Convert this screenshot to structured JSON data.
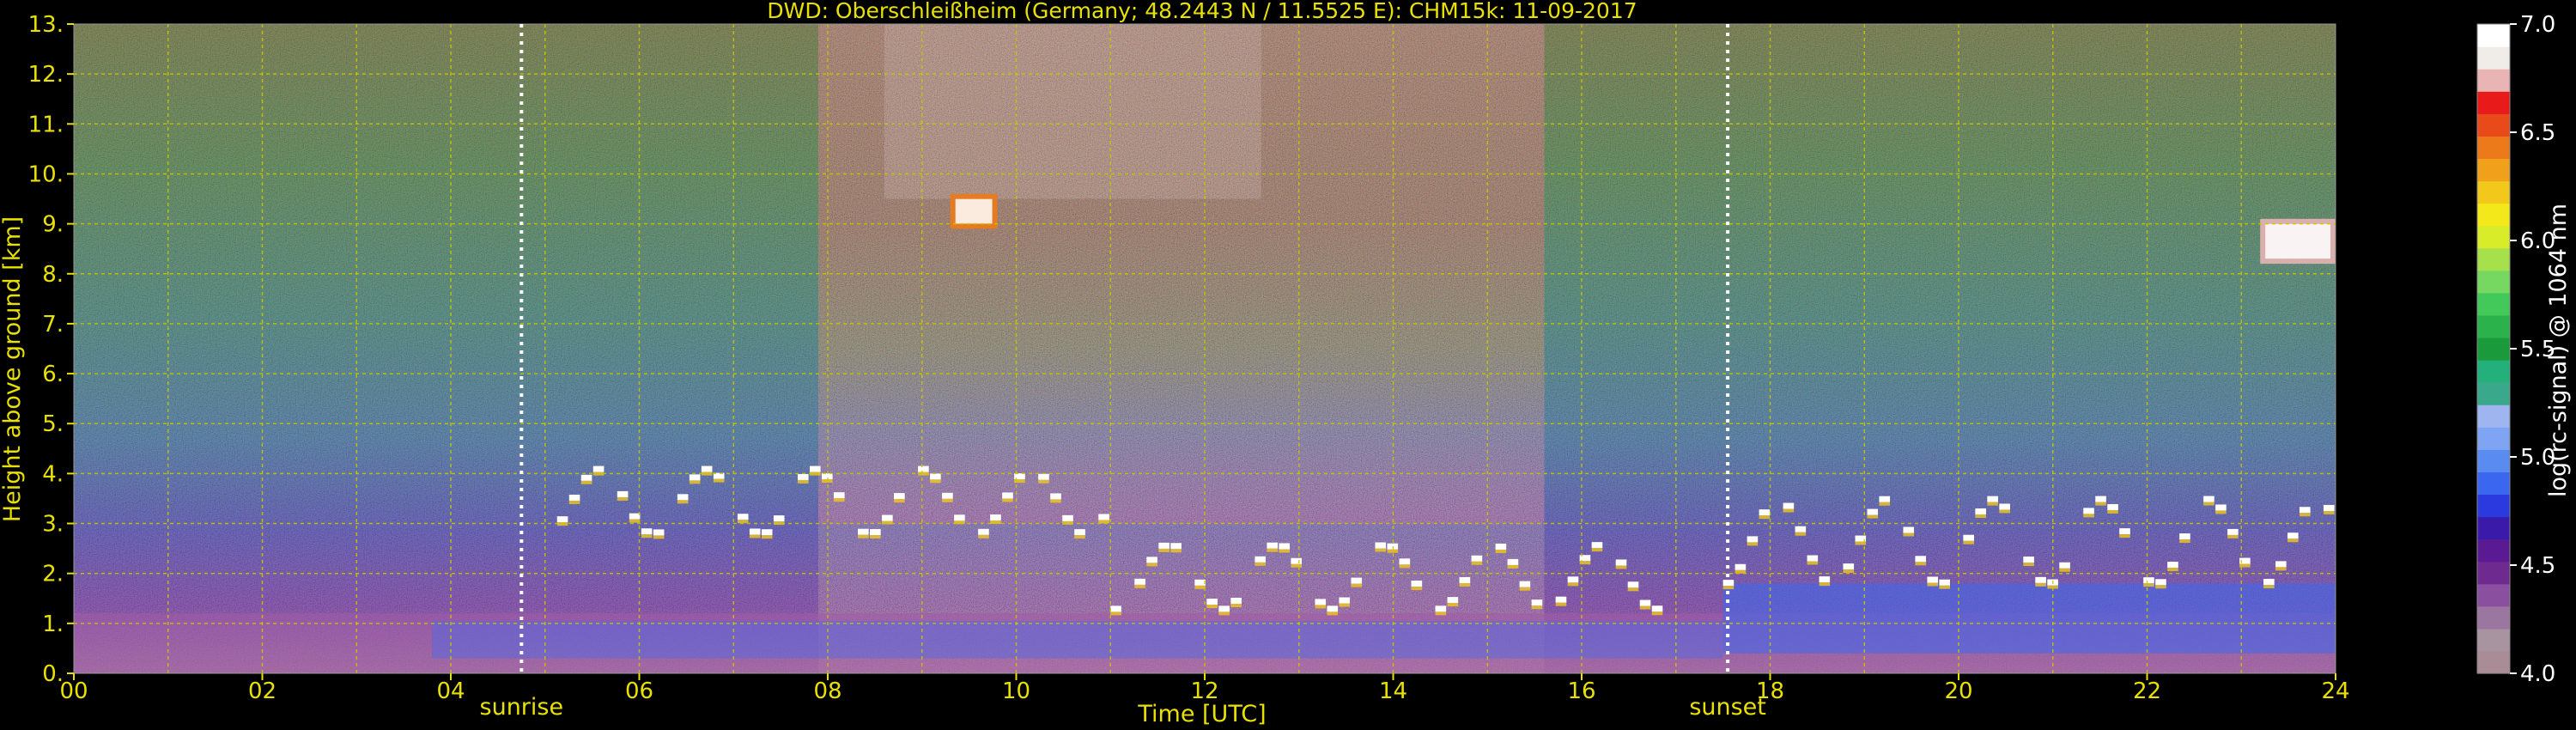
{
  "chart_data": {
    "type": "heatmap",
    "title": "DWD: Oberschleißheim (Germany; 48.2443 N / 11.5525 E):    CHM15k: 11-09-2017",
    "xlabel": "Time [UTC]",
    "ylabel": "Height above ground [km]",
    "xlim": [
      0,
      24
    ],
    "ylim": [
      0,
      13
    ],
    "x_ticks": [
      "00",
      "02",
      "04",
      "06",
      "08",
      "10",
      "12",
      "14",
      "16",
      "18",
      "20",
      "22",
      "24"
    ],
    "y_ticks": [
      "0.",
      "1.",
      "2.",
      "3.",
      "4.",
      "5.",
      "6.",
      "7.",
      "8.",
      "9.",
      "10.",
      "11.",
      "12.",
      "13."
    ],
    "grid": true,
    "annotations": [
      {
        "label": "sunrise",
        "x": 4.75
      },
      {
        "label": "sunset",
        "x": 17.55
      }
    ],
    "colorbar": {
      "label": "log(rc-signal) @ 1064 nm",
      "range": [
        4.0,
        7.0
      ],
      "ticks": [
        "4.0",
        "4.5",
        "5.0",
        "5.5",
        "6.0",
        "6.5",
        "7.0"
      ],
      "colors": [
        "#a98c95",
        "#a893a0",
        "#9a76a0",
        "#8a4f9e",
        "#6f2a8f",
        "#5a1a93",
        "#3a1aa8",
        "#2a3adf",
        "#3a66f0",
        "#5a8bf0",
        "#7fa4f4",
        "#9fb5f0",
        "#3aa88a",
        "#23b07a",
        "#1a9a3a",
        "#2bb24a",
        "#43c85a",
        "#76d860",
        "#a6e04a",
        "#d8ec2a",
        "#f2e81a",
        "#f2c81a",
        "#f0a01a",
        "#ec7a1a",
        "#e84a1a",
        "#e81a1a",
        "#e8b4b4",
        "#f0ede8",
        "#ffffff"
      ]
    },
    "features": [
      {
        "name": "boundary layer aerosol",
        "x_range": [
          0,
          24
        ],
        "height_km": [
          0,
          1.2
        ],
        "value": 4.5
      },
      {
        "name": "cloud layer",
        "x_range": [
          5,
          11
        ],
        "height_km": [
          2.8,
          4.1
        ],
        "value": 7.0
      },
      {
        "name": "cloud layer",
        "x_range": [
          11,
          17
        ],
        "height_km": [
          1.3,
          2.6
        ],
        "value": 7.0
      },
      {
        "name": "cloud layer",
        "x_range": [
          17.5,
          24
        ],
        "height_km": [
          1.8,
          3.5
        ],
        "value": 7.0
      },
      {
        "name": "cirrus",
        "x_range": [
          9.3,
          9.8
        ],
        "height_km": [
          8.9,
          9.6
        ],
        "value": 6.5
      },
      {
        "name": "cirrus",
        "x_range": [
          23.2,
          24
        ],
        "height_km": [
          8.2,
          9.1
        ],
        "value": 6.8
      }
    ]
  },
  "colors": {
    "text": "#e8e000",
    "grid": "#c8c800",
    "marker": "#ffffff",
    "colorbar_label": "#ffffff"
  }
}
